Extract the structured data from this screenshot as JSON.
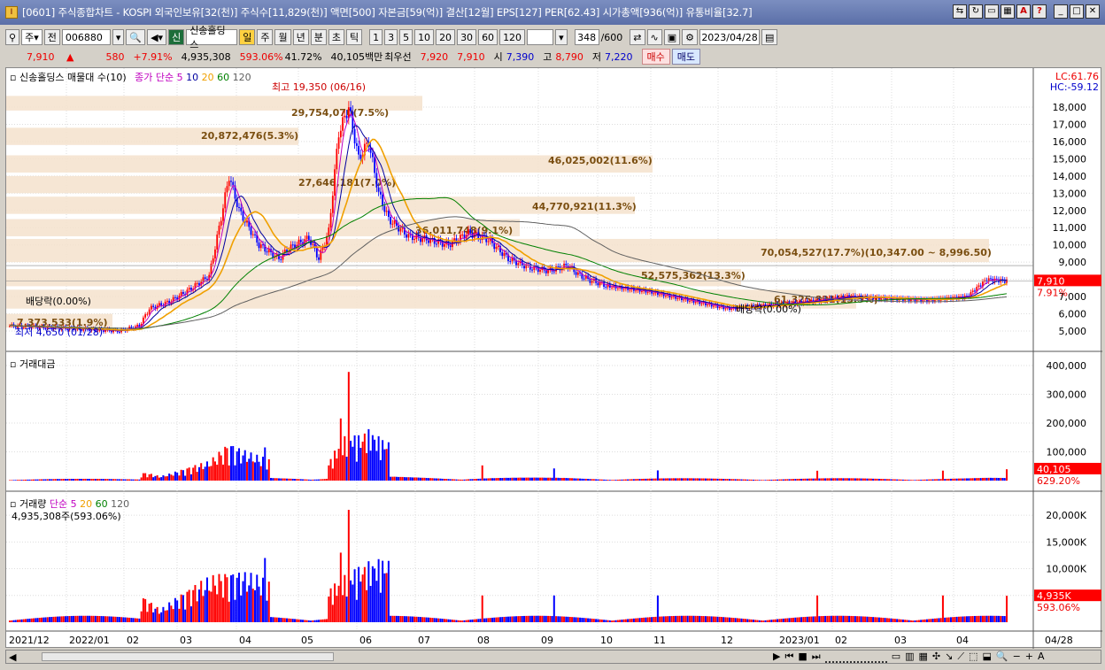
{
  "window": {
    "title": "[0601] 주식종합차트 - KOSPI 외국인보유[32(천)] 주식수[11,829(천)] 액면[500] 자본금[59(억)] 결산[12월] EPS[127] PER[62.43] 시가총액[936(억)] 유통비율[32.7]"
  },
  "toolbar": {
    "market_type": "주",
    "code_label": "전",
    "code": "006880",
    "stock_name": "신송홀딩스",
    "period_tabs": [
      "일",
      "주",
      "월",
      "년",
      "분",
      "초",
      "틱"
    ],
    "intervals": [
      "1",
      "3",
      "5",
      "10",
      "20",
      "30",
      "60",
      "120"
    ],
    "count": "348",
    "max_count": "/600",
    "date": "2023/04/28"
  },
  "quote": {
    "price": "7,910",
    "arrow": "▲",
    "change": "580",
    "rate": "+7.91%",
    "volume": "4,935,308",
    "vol_ratio": "593.06%",
    "turnover": "41.72%",
    "amount": "40,105백만",
    "best_bid_label": "최우선",
    "best_ask": "7,920",
    "best_bid": "7,910",
    "open_label": "시",
    "open": "7,390",
    "high_label": "고",
    "high": "8,790",
    "low_label": "저",
    "low": "7,220",
    "buy": "매수",
    "sell": "매도"
  },
  "price_panel": {
    "legend_name": "신송홀딩스 매물대 수(10)",
    "ma_label": "종가 단순",
    "ma_periods": [
      "5",
      "10",
      "20",
      "60",
      "120"
    ],
    "lc": "LC:61.76",
    "hc": "HC:-59.12",
    "max_annotation": "최고 19,350 (06/16)",
    "min_annotation": "최저 4,650 (01/28)",
    "dividend_left": "배당락(0.00%)",
    "dividend_right": "배당락(0.00%)",
    "last_price_box": "7,910",
    "last_rate_box": "7.91%",
    "y_ticks": [
      "18,000",
      "17,000",
      "16,000",
      "15,000",
      "14,000",
      "13,000",
      "12,000",
      "11,000",
      "10,000",
      "9,000",
      "8,000",
      "7,000",
      "6,000",
      "5,000"
    ],
    "volume_profile": [
      "29,754,070(7.5%)",
      "20,872,476(5.3%)",
      "46,025,002(11.6%)",
      "27,646,181(7.0%)",
      "44,770,921(11.3%)",
      "36,011,748(9.1%)",
      "70,054,527(17.7%)(10,347.00 ~ 8,996.50)",
      "52,575,362(13.3%)",
      "61,325,821(15.5%)",
      "7,373,533(1.9%)"
    ]
  },
  "amount_panel": {
    "label": "거래대금",
    "y_ticks": [
      "400,000",
      "300,000",
      "200,000",
      "100,000"
    ],
    "last_box": "40,105",
    "last_rate": "629.20%"
  },
  "volume_panel": {
    "label": "거래량",
    "ma_label": "단순",
    "ma_periods": [
      "5",
      "20",
      "60",
      "120"
    ],
    "value_text": "4,935,308주(593.06%)",
    "y_ticks": [
      "20,000K",
      "15,000K",
      "10,000K",
      "5,000K"
    ],
    "last_box": "4,935K",
    "last_rate": "593.06%"
  },
  "x_axis": [
    "2021/12",
    "2022/01",
    "02",
    "03",
    "04",
    "05",
    "06",
    "07",
    "08",
    "09",
    "10",
    "11",
    "12",
    "2023/01",
    "02",
    "03",
    "04",
    "04/28"
  ],
  "colors": {
    "up": "#ff0000",
    "down": "#0000ff",
    "ma5": "#c000c0",
    "ma10": "#0000a0",
    "ma20": "#f0a000",
    "ma60": "#008000",
    "ma120": "#606060",
    "volume_band": "#f5e2cc"
  }
}
